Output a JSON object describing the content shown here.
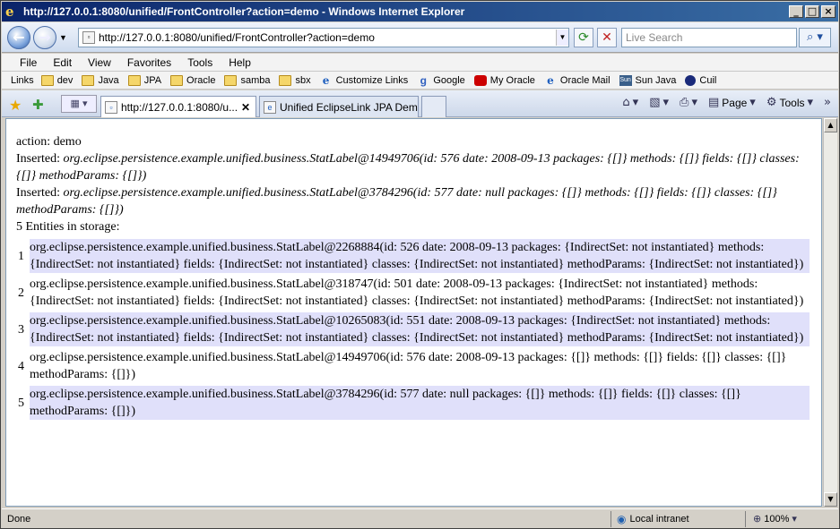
{
  "window": {
    "title": "http://127.0.0.1:8080/unified/FrontController?action=demo - Windows Internet Explorer"
  },
  "address_bar": {
    "url": "http://127.0.0.1:8080/unified/FrontController?action=demo",
    "search_placeholder": "Live Search"
  },
  "menu": {
    "items": [
      "File",
      "Edit",
      "View",
      "Favorites",
      "Tools",
      "Help"
    ]
  },
  "links_bar": {
    "label": "Links",
    "items": [
      {
        "label": "dev",
        "icon": "folder-icon"
      },
      {
        "label": "Java",
        "icon": "folder-icon"
      },
      {
        "label": "JPA",
        "icon": "folder-icon"
      },
      {
        "label": "Oracle",
        "icon": "folder-icon"
      },
      {
        "label": "samba",
        "icon": "folder-icon"
      },
      {
        "label": "sbx",
        "icon": "folder-icon"
      },
      {
        "label": "Customize Links",
        "icon": "ie-page-icon"
      },
      {
        "label": "Google",
        "icon": "google-icon"
      },
      {
        "label": "My Oracle",
        "icon": "oracle-icon"
      },
      {
        "label": "Oracle Mail",
        "icon": "ie-page-icon"
      },
      {
        "label": "Sun Java",
        "icon": "sun-icon"
      },
      {
        "label": "Cuil",
        "icon": "cuil-icon"
      }
    ]
  },
  "tabs": {
    "active_title": "http://127.0.0.1:8080/u...",
    "inactive_title": "Unified EclipseLink JPA Demo"
  },
  "command_bar": {
    "page_label": "Page",
    "tools_label": "Tools"
  },
  "content": {
    "action_line": "action: demo",
    "inserted": [
      {
        "label": "Inserted:",
        "value": "org.eclipse.persistence.example.unified.business.StatLabel@14949706(id: 576 date: 2008-09-13 packages: {[]} methods: {[]} fields: {[]} classes: {[]} methodParams: {[]})"
      },
      {
        "label": "Inserted:",
        "value": "org.eclipse.persistence.example.unified.business.StatLabel@3784296(id: 577 date: null packages: {[]} methods: {[]} fields: {[]} classes: {[]} methodParams: {[]})"
      }
    ],
    "storage_heading": "5 Entities in storage:",
    "storage_rows": [
      {
        "index": "1",
        "value": "org.eclipse.persistence.example.unified.business.StatLabel@2268884(id: 526 date: 2008-09-13 packages: {IndirectSet: not instantiated} methods: {IndirectSet: not instantiated} fields: {IndirectSet: not instantiated} classes: {IndirectSet: not instantiated} methodParams: {IndirectSet: not instantiated})"
      },
      {
        "index": "2",
        "value": "org.eclipse.persistence.example.unified.business.StatLabel@318747(id: 501 date: 2008-09-13 packages: {IndirectSet: not instantiated} methods: {IndirectSet: not instantiated} fields: {IndirectSet: not instantiated} classes: {IndirectSet: not instantiated} methodParams: {IndirectSet: not instantiated})"
      },
      {
        "index": "3",
        "value": "org.eclipse.persistence.example.unified.business.StatLabel@10265083(id: 551 date: 2008-09-13 packages: {IndirectSet: not instantiated} methods: {IndirectSet: not instantiated} fields: {IndirectSet: not instantiated} classes: {IndirectSet: not instantiated} methodParams: {IndirectSet: not instantiated})"
      },
      {
        "index": "4",
        "value": "org.eclipse.persistence.example.unified.business.StatLabel@14949706(id: 576 date: 2008-09-13 packages: {[]} methods: {[]} fields: {[]} classes: {[]} methodParams: {[]})"
      },
      {
        "index": "5",
        "value": "org.eclipse.persistence.example.unified.business.StatLabel@3784296(id: 577 date: null packages: {[]} methods: {[]} fields: {[]} classes: {[]} methodParams: {[]})"
      }
    ],
    "row_shade_color": "#e0e0fa"
  },
  "status_bar": {
    "status": "Done",
    "zone": "Local intranet",
    "zoom": "100%"
  }
}
